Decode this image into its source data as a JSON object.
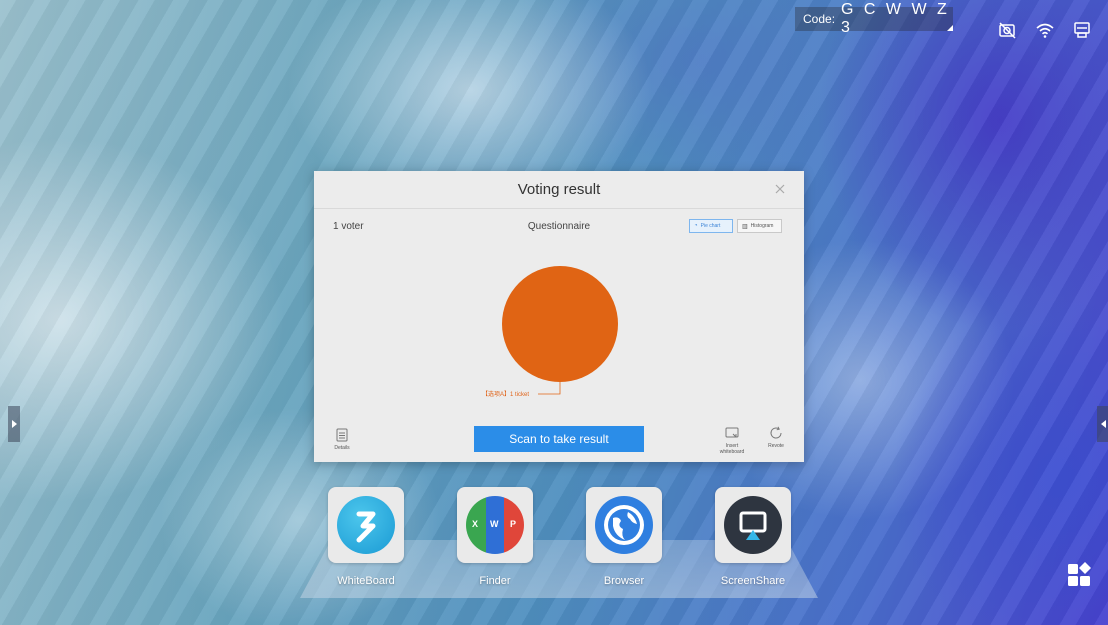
{
  "status_bar": {
    "code_label": "Code:",
    "code_value": "G C W W Z 3",
    "icons": [
      "camera-off-icon",
      "wifi-icon",
      "screen-cast-icon"
    ]
  },
  "dialog": {
    "title": "Voting result",
    "voter_count": "1 voter",
    "questionnaire_title": "Questionnaire",
    "view_toggle": {
      "pie_chart": "Pie chart",
      "histogram": "Histogram",
      "selected": "Pie chart"
    },
    "slice_label": "【选项A】1 ticket",
    "scan_button": "Scan to take result",
    "details_label": "Details",
    "insert_whiteboard_label": "Insert whiteboard",
    "revote_label": "Revote",
    "accent_color": "#2b8de8"
  },
  "chart_data": {
    "type": "pie",
    "categories": [
      "【选项A】"
    ],
    "values": [
      1
    ],
    "unit": "ticket",
    "colors": [
      "#e06414"
    ]
  },
  "dock": {
    "apps": [
      {
        "label": "WhiteBoard",
        "icon": "whiteboard-icon"
      },
      {
        "label": "Finder",
        "icon": "finder-icon"
      },
      {
        "label": "Browser",
        "icon": "browser-icon"
      },
      {
        "label": "ScreenShare",
        "icon": "screenshare-icon"
      }
    ],
    "finder_letters": [
      "X",
      "W",
      "P"
    ]
  }
}
